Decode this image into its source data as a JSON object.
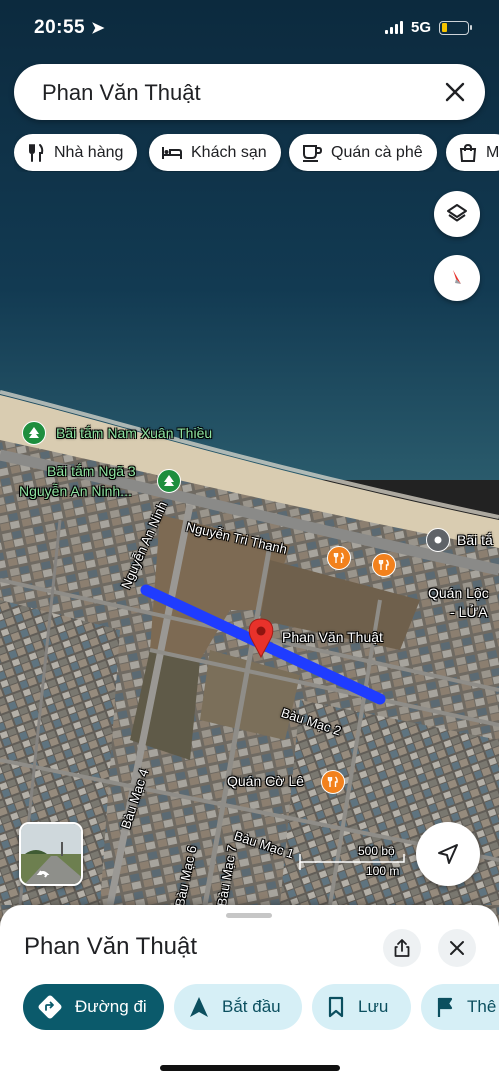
{
  "status_bar": {
    "time": "20:55",
    "network": "5G"
  },
  "search": {
    "query": "Phan Văn Thuật"
  },
  "chips": [
    {
      "label": "Nhà hàng",
      "icon": "fork-knife-icon"
    },
    {
      "label": "Khách sạn",
      "icon": "bed-icon"
    },
    {
      "label": "Quán cà phê",
      "icon": "coffee-cup-icon"
    },
    {
      "label": "M",
      "icon": "shopping-bag-icon"
    }
  ],
  "map": {
    "labels": {
      "beach_1": "Bãi tắm Nam Xuân Thiều",
      "beach_2_line1": "Bãi tắm Ngã 3",
      "beach_2_line2": "Nguyễn An Ninh...",
      "beach_3": "Bãi tắ",
      "street_nguyen_tri_thanh": "Nguyễn Tri Thanh",
      "street_nguyen_an_ninh": "Nguyễn An Ninh",
      "selected_place": "Phan Văn Thuật",
      "quan_loc_line1": "Quán Lộc",
      "quan_loc_line2": "- LỬA",
      "street_bau_mac_2": "Bàu Mạc 2",
      "quan_co_le": "Quán Cờ Lê",
      "street_bau_mac_4": "Bàu Mạc 4",
      "street_bau_mac_1": "Bàu Mạc 1",
      "street_bau_mac_6": "Bàu Mạc 6",
      "street_bau_mac_7": "Bàu Mạc 7"
    },
    "scale": {
      "imperial": "500 bộ",
      "metric": "100 m"
    },
    "route_color": "#1f3cff",
    "pin_color": "#e8322b"
  },
  "sheet": {
    "title": "Phan Văn Thuật",
    "actions": [
      {
        "label": "Đường đi",
        "icon": "directions-icon",
        "style": "primary"
      },
      {
        "label": "Bắt đầu",
        "icon": "navigation-arrow-icon",
        "style": "secondary"
      },
      {
        "label": "Lưu",
        "icon": "bookmark-icon",
        "style": "secondary"
      },
      {
        "label": "Thê",
        "icon": "flag-icon",
        "style": "secondary"
      }
    ]
  }
}
